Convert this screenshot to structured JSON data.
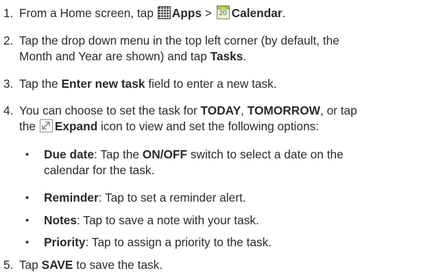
{
  "steps": [
    {
      "num": "1.",
      "t1": "From a Home screen, tap ",
      "b1": "Apps",
      "t2": " > ",
      "b2": "Calendar",
      "t3": "."
    },
    {
      "num": "2.",
      "line1": "Tap the drop down menu in the top left corner (by default, the",
      "line2_pre": "Month and Year are shown) and tap ",
      "line2_b": "Tasks",
      "line2_post": "."
    },
    {
      "num": "3.",
      "t1": "Tap the ",
      "b1": "Enter new task",
      "t2": " field to enter a new task."
    },
    {
      "num": "4.",
      "line1_pre": "You can choose to set the task for ",
      "line1_b1": "TODAY",
      "line1_mid": ", ",
      "line1_b2": "TOMORROW",
      "line1_post": ", or tap",
      "line2_pre": "the ",
      "line2_b": "Expand",
      "line2_post": " icon to view and set the following options:"
    },
    {
      "num": "5.",
      "t1": "Tap ",
      "b1": "SAVE",
      "t2": " to save the task."
    }
  ],
  "bullets": [
    {
      "marker": "•",
      "label": "Due date",
      "line1_mid": ": Tap the ",
      "line1_b": "ON/OFF",
      "line1_post": " switch to select a date on the",
      "line2": "calendar for the task."
    },
    {
      "marker": "•",
      "label": "Reminder",
      "text": ": Tap to set a reminder alert."
    },
    {
      "marker": "•",
      "label": "Notes",
      "text": ": Tap to save a note with your task."
    },
    {
      "marker": "•",
      "label": "Priority",
      "text": ": Tap to assign a priority to the task."
    }
  ],
  "icons": {
    "apps": "apps-grid-icon",
    "calendar": "calendar-icon",
    "calendar_month": "Mon",
    "calendar_day": "20",
    "expand": "expand-icon"
  }
}
